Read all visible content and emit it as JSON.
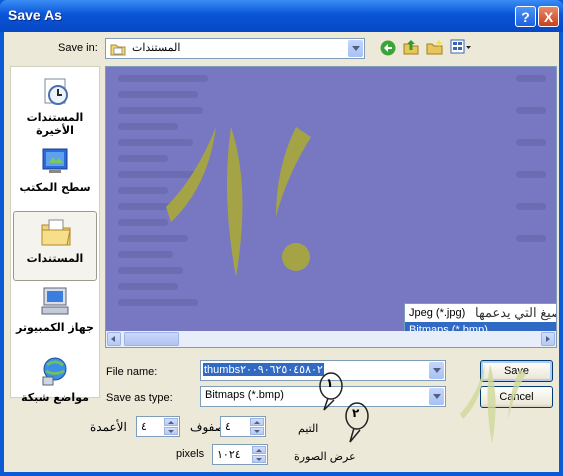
{
  "window": {
    "title": "Save As",
    "help_label": "?",
    "close_label": "X"
  },
  "toolbar": {
    "save_in_label": "Save in:",
    "save_in_value": "المستندات",
    "icons": [
      "back-icon",
      "up-folder-icon",
      "new-folder-icon",
      "views-menu-icon"
    ]
  },
  "places": [
    {
      "label": "المستندات الأخيرة",
      "icon": "recent-documents-icon"
    },
    {
      "label": "سطح المكتب",
      "icon": "desktop-icon"
    },
    {
      "label": "المستندات",
      "icon": "my-documents-icon",
      "selected": true
    },
    {
      "label": "جهاز الكمبيوتر",
      "icon": "my-computer-icon"
    },
    {
      "label": "مواضع شبكة",
      "icon": "network-places-icon"
    }
  ],
  "filetype_dropdown": {
    "options": [
      "Jpeg (*.jpg)",
      "Bitmaps (*.bmp)"
    ],
    "highlighted": "Bitmaps (*.bmp)",
    "annotation": "الصيغ التي يدعمها"
  },
  "fields": {
    "file_name_label": "File name:",
    "file_name_value": "thumbs٢٠٠٩٠٦٢٥٠٤٥٨٠٢",
    "save_type_label": "Save as type:",
    "save_type_value": "Bitmaps (*.bmp)"
  },
  "buttons": {
    "save": "Save",
    "cancel": "Cancel"
  },
  "thumb_options": {
    "columns_label": "الأعمدة",
    "columns_value": "٤",
    "rows_label": "صفوف",
    "rows_value": "٤",
    "spacing_label": "التيم",
    "width_label": "عرض الصورة",
    "width_value": "١٠٢٤",
    "width_unit": "pixels"
  },
  "callouts": [
    "١",
    "٢"
  ]
}
